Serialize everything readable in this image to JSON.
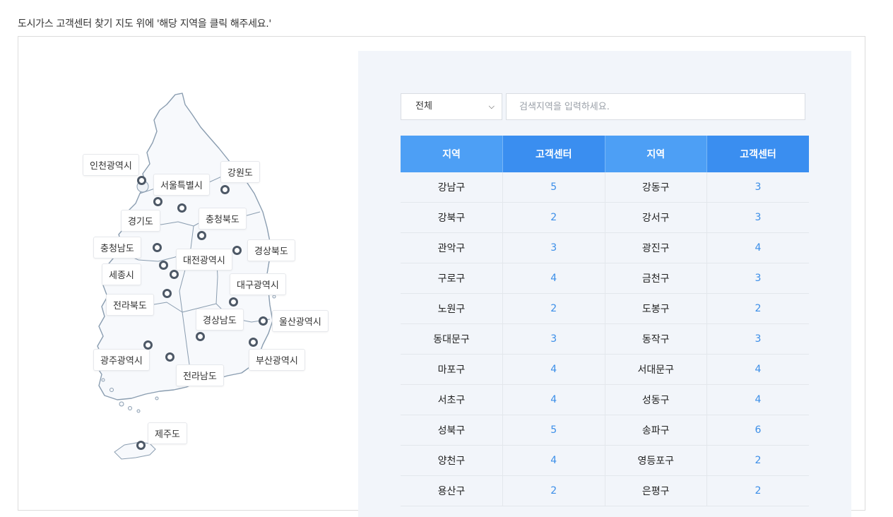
{
  "instruction": "도시가스 고객센터 찾기 지도 위에 '해당 지역을 클릭 해주세요.'",
  "map": {
    "regions": [
      {
        "name": "인천광역시"
      },
      {
        "name": "서울특별시"
      },
      {
        "name": "강원도"
      },
      {
        "name": "충청북도"
      },
      {
        "name": "경기도"
      },
      {
        "name": "충청남도"
      },
      {
        "name": "대전광역시"
      },
      {
        "name": "경상북도"
      },
      {
        "name": "세종시"
      },
      {
        "name": "대구광역시"
      },
      {
        "name": "전라북도"
      },
      {
        "name": "경상남도"
      },
      {
        "name": "울산광역시"
      },
      {
        "name": "광주광역시"
      },
      {
        "name": "부산광역시"
      },
      {
        "name": "전라남도"
      },
      {
        "name": "제주도"
      }
    ]
  },
  "filter": {
    "selected": "전체",
    "search_placeholder": "검색지역을 입력하세요."
  },
  "table": {
    "headers": [
      "지역",
      "고객센터",
      "지역",
      "고객센터"
    ],
    "rows": [
      [
        "강남구",
        "5",
        "강동구",
        "3"
      ],
      [
        "강북구",
        "2",
        "강서구",
        "3"
      ],
      [
        "관악구",
        "3",
        "광진구",
        "4"
      ],
      [
        "구로구",
        "4",
        "금천구",
        "3"
      ],
      [
        "노원구",
        "2",
        "도봉구",
        "2"
      ],
      [
        "동대문구",
        "3",
        "동작구",
        "3"
      ],
      [
        "마포구",
        "4",
        "서대문구",
        "4"
      ],
      [
        "서초구",
        "4",
        "성동구",
        "4"
      ],
      [
        "성북구",
        "5",
        "송파구",
        "6"
      ],
      [
        "양천구",
        "4",
        "영등포구",
        "2"
      ],
      [
        "용산구",
        "2",
        "은평구",
        "2"
      ]
    ]
  },
  "colors": {
    "header_light": "#4d9ff5",
    "header_dark": "#3a8ef0",
    "count_text": "#3b8ee8",
    "panel_bg": "#f2f5fa",
    "map_fill": "#f7f9fc",
    "map_stroke": "#8a9db0"
  }
}
